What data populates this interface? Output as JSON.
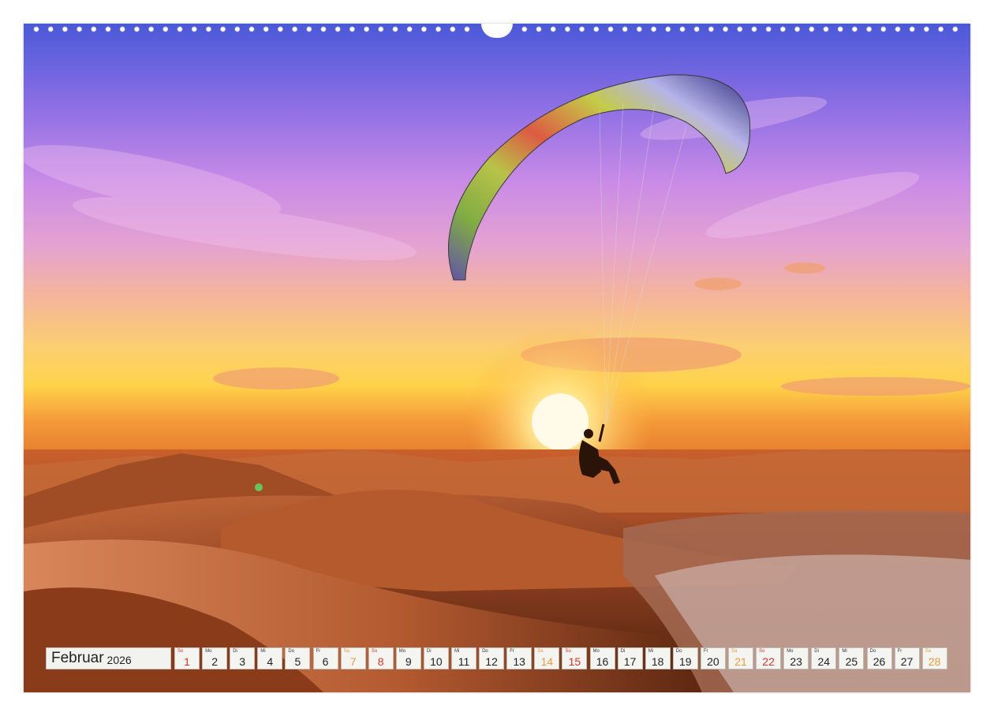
{
  "calendar": {
    "month": "Februar",
    "year": "2026",
    "days": [
      {
        "wd": "So",
        "num": "1",
        "type": "sun"
      },
      {
        "wd": "Mo",
        "num": "2",
        "type": "wd"
      },
      {
        "wd": "Di",
        "num": "3",
        "type": "wd"
      },
      {
        "wd": "Mi",
        "num": "4",
        "type": "wd"
      },
      {
        "wd": "Do",
        "num": "5",
        "type": "wd"
      },
      {
        "wd": "Fr",
        "num": "6",
        "type": "wd"
      },
      {
        "wd": "Sa",
        "num": "7",
        "type": "sat"
      },
      {
        "wd": "So",
        "num": "8",
        "type": "sun"
      },
      {
        "wd": "Mo",
        "num": "9",
        "type": "wd"
      },
      {
        "wd": "Di",
        "num": "10",
        "type": "wd"
      },
      {
        "wd": "Mi",
        "num": "11",
        "type": "wd"
      },
      {
        "wd": "Do",
        "num": "12",
        "type": "wd"
      },
      {
        "wd": "Fr",
        "num": "13",
        "type": "wd"
      },
      {
        "wd": "Sa",
        "num": "14",
        "type": "sat"
      },
      {
        "wd": "So",
        "num": "15",
        "type": "sun"
      },
      {
        "wd": "Mo",
        "num": "16",
        "type": "wd"
      },
      {
        "wd": "Di",
        "num": "17",
        "type": "wd"
      },
      {
        "wd": "Mi",
        "num": "18",
        "type": "wd"
      },
      {
        "wd": "Do",
        "num": "19",
        "type": "wd"
      },
      {
        "wd": "Fr",
        "num": "20",
        "type": "wd"
      },
      {
        "wd": "Sa",
        "num": "21",
        "type": "sat"
      },
      {
        "wd": "So",
        "num": "22",
        "type": "sun"
      },
      {
        "wd": "Mo",
        "num": "23",
        "type": "wd"
      },
      {
        "wd": "Di",
        "num": "24",
        "type": "wd"
      },
      {
        "wd": "Mi",
        "num": "25",
        "type": "wd"
      },
      {
        "wd": "Do",
        "num": "26",
        "type": "wd"
      },
      {
        "wd": "Fr",
        "num": "27",
        "type": "wd"
      },
      {
        "wd": "Sa",
        "num": "28",
        "type": "sat"
      }
    ]
  },
  "colors": {
    "saturday": "#e79b3c",
    "sunday": "#d9332a"
  }
}
